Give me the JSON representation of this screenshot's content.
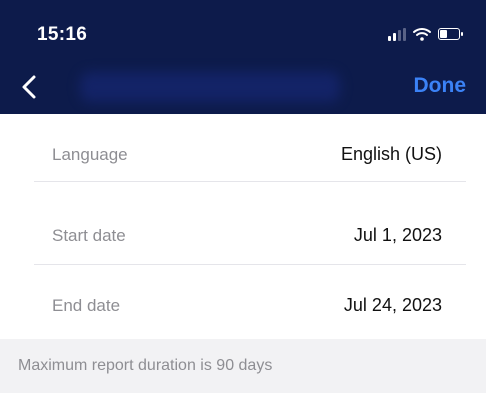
{
  "status_bar": {
    "time": "15:16",
    "icons": [
      "signal-icon",
      "wifi-icon",
      "battery-icon"
    ]
  },
  "nav": {
    "back_icon": "chevron-left-icon",
    "done_label": "Done",
    "accent_color": "#3b82f6",
    "background_color": "#0d1b4b"
  },
  "settings": {
    "language": {
      "label": "Language",
      "value": "English (US)"
    },
    "start_date": {
      "label": "Start date",
      "value": "Jul 1, 2023"
    },
    "end_date": {
      "label": "End date",
      "value": "Jul 24, 2023"
    }
  },
  "footer": {
    "note": "Maximum report duration is 90 days"
  }
}
